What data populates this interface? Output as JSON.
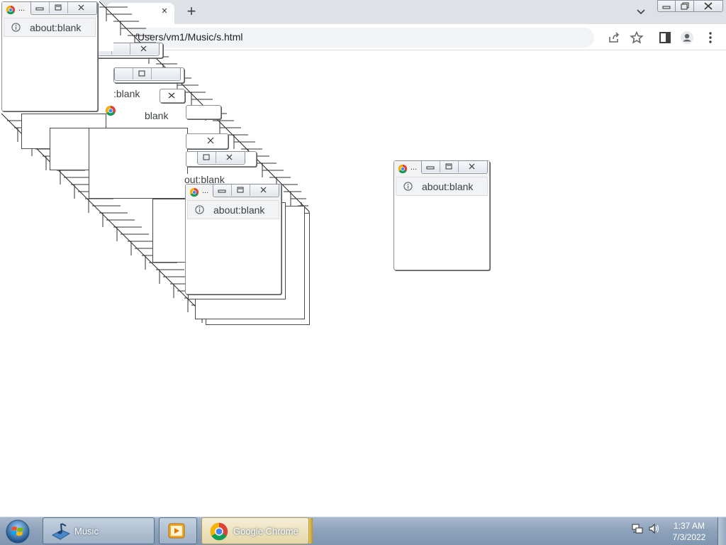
{
  "browser": {
    "address_url": "C:/Users/vm1/Music/s.html",
    "new_tab_symbol": "+",
    "tab_close_symbol": "×"
  },
  "popups": {
    "title_ellipsis": "...",
    "address_text": "about:blank",
    "fragment_text": "about:blank",
    "fragment_text_b": ":blank",
    "fragment_text_c": "blank",
    "fragment_text_d": "out:blank"
  },
  "taskbar": {
    "items": [
      {
        "label": "Music"
      },
      {
        "label": ""
      },
      {
        "label": "Google Chrome"
      }
    ],
    "clock_time": "1:37 AM",
    "clock_date": "7/3/2022"
  },
  "colors": {
    "taskbar": "#8ea3bb",
    "tabstrip": "#dee1e6",
    "chrome_red": "#db4437",
    "chrome_yellow": "#f4b400",
    "chrome_green": "#0f9d58",
    "chrome_blue": "#4285f4"
  },
  "icons": [
    "chrome-icon",
    "info-icon",
    "minimize-icon",
    "maximize-icon",
    "close-icon",
    "share-icon",
    "star-icon",
    "side-panel-icon",
    "profile-icon",
    "menu-icon",
    "windows-start-icon",
    "music-folder-icon",
    "media-player-icon",
    "network-icon",
    "volume-icon"
  ]
}
